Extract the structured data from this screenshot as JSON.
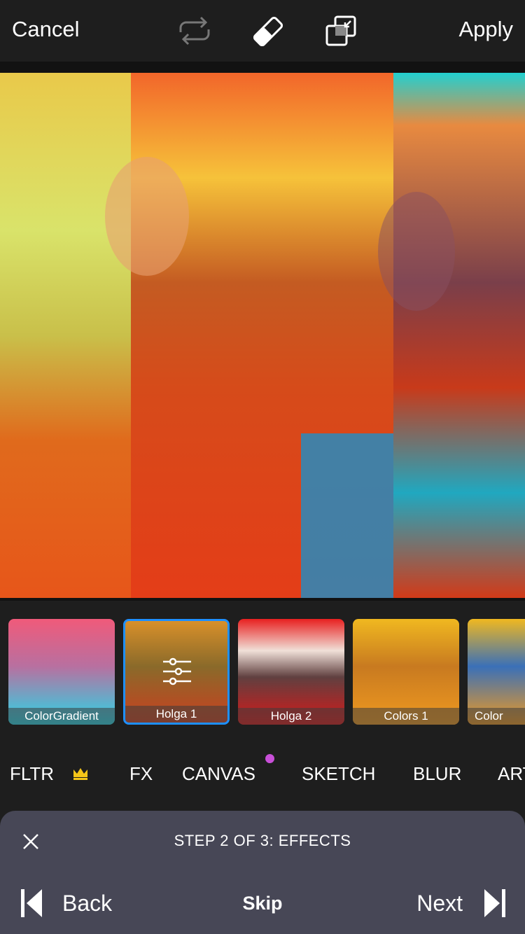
{
  "topbar": {
    "cancel": "Cancel",
    "apply": "Apply",
    "icons": [
      "repeat-icon",
      "eraser-icon",
      "blend-icon"
    ]
  },
  "thumbnails": [
    {
      "label": "ColorGradient",
      "selected": false
    },
    {
      "label": "Holga 1",
      "selected": true
    },
    {
      "label": "Holga 2",
      "selected": false
    },
    {
      "label": "Colors 1",
      "selected": false
    },
    {
      "label": "Color",
      "selected": false
    }
  ],
  "categories": [
    {
      "label": "FLTR",
      "badge": "crown-icon"
    },
    {
      "label": "FX"
    },
    {
      "label": "CANVAS",
      "dot": "#c84fd8"
    },
    {
      "label": "SKETCH"
    },
    {
      "label": "BLUR"
    },
    {
      "label": "ART"
    }
  ],
  "tutorial": {
    "step": "STEP 2 OF 3: EFFECTS",
    "back": "Back",
    "skip": "Skip",
    "next": "Next"
  },
  "colors": {
    "selected_border": "#1e90ff",
    "panel": "#474756",
    "dot": "#c84fd8",
    "crown": "#f5c518"
  }
}
